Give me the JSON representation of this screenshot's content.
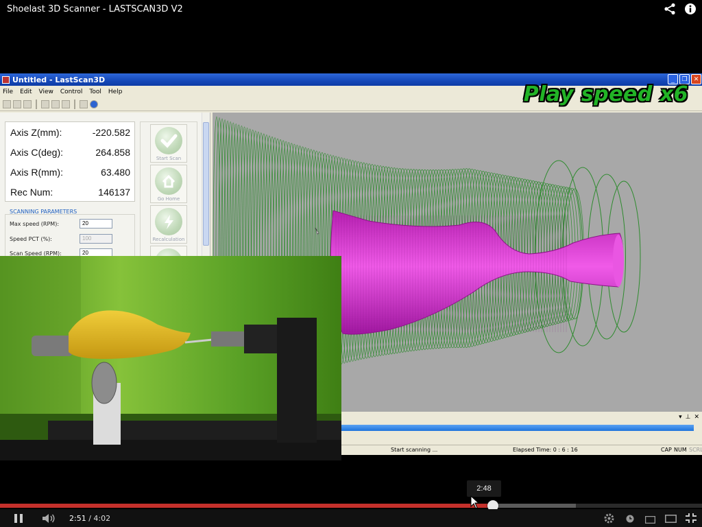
{
  "video": {
    "title": "Shoelast 3D Scanner - LASTSCAN3D V2",
    "current_time": "2:51",
    "separator": " / ",
    "duration": "4:02",
    "hover_time": "2:48",
    "played_fraction": 0.7,
    "buffered_fraction": 0.82
  },
  "window": {
    "title": "Untitled - LastScan3D",
    "menu": [
      "File",
      "Edit",
      "View",
      "Control",
      "Tool",
      "Help"
    ]
  },
  "overlay": {
    "play_speed": "Play speed x6"
  },
  "axes": [
    {
      "label": "Axis Z(mm):",
      "value": "-220.582"
    },
    {
      "label": "Axis C(deg):",
      "value": "264.858"
    },
    {
      "label": "Axis R(mm):",
      "value": "63.480"
    },
    {
      "label": "Rec Num:",
      "value": "146137"
    }
  ],
  "params": {
    "title": "SCANNING PARAMETERS",
    "max_speed_label": "Max speed (RPM):",
    "max_speed_value": "20",
    "speed_pct_label": "Speed PCT (%):",
    "speed_pct_value": "100",
    "scan_speed_label": "Scan Speed (RPM):",
    "scan_speed_value": "20"
  },
  "buttons": {
    "start_scan": "Start Scan",
    "go_home": "Go Home",
    "recalculation": "Recalculation"
  },
  "status": {
    "message": "Start scanning ...",
    "elapsed": "Elapsed Time:  0 :  6 : 16",
    "cap": "CAP",
    "num": "NUM",
    "scrl": "SCRL"
  },
  "colors": {
    "progress_played": "#c4302b",
    "mesh_green": "#2e8b2e",
    "model_magenta": "#d62bd0",
    "play_speed_text": "#22b326"
  }
}
